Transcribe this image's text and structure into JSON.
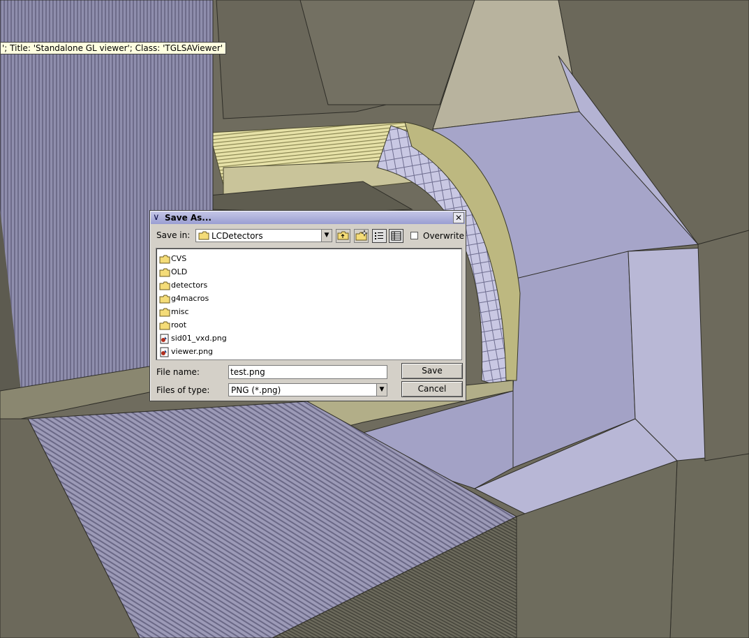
{
  "tooltip": {
    "text": "'; Title: 'Standalone GL viewer'; Class: 'TGLSAViewer'"
  },
  "dialog": {
    "title": "Save As...",
    "save_in_label": "Save in:",
    "current_folder": "LCDetectors",
    "overwrite_label": "Overwrite",
    "overwrite_checked": false,
    "files": [
      {
        "name": "CVS",
        "type": "folder"
      },
      {
        "name": "OLD",
        "type": "folder"
      },
      {
        "name": "detectors",
        "type": "folder"
      },
      {
        "name": "g4macros",
        "type": "folder"
      },
      {
        "name": "misc",
        "type": "folder"
      },
      {
        "name": "root",
        "type": "folder"
      },
      {
        "name": "sid01_vxd.png",
        "type": "image"
      },
      {
        "name": "viewer.png",
        "type": "image"
      }
    ],
    "file_name_label": "File name:",
    "file_name_value": "test.png",
    "files_of_type_label": "Files of type:",
    "files_of_type_value": "PNG (*.png)",
    "save_label": "Save",
    "cancel_label": "Cancel"
  },
  "colors": {
    "dialog_bg": "#d4d0c8",
    "title_gradient": [
      "#c4c6e6",
      "#9a9ed2"
    ],
    "calorimeter_gray": "#6f6c5e",
    "detector_lavender": "#a6a5c9",
    "tracker_yellow": "#e7e2a8"
  }
}
